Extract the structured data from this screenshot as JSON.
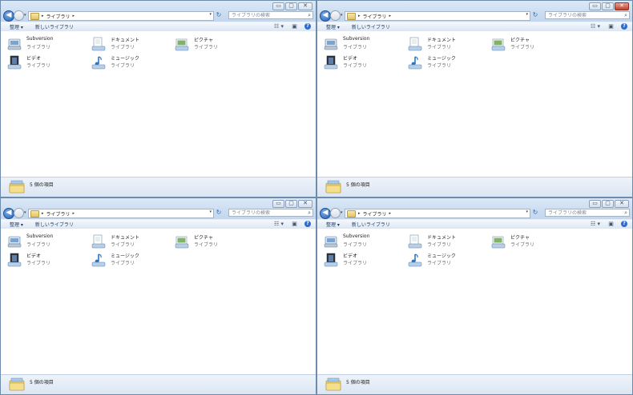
{
  "windows": [
    {
      "close_active": false
    },
    {
      "close_active": true
    },
    {
      "close_active": false
    },
    {
      "close_active": false
    }
  ],
  "caption": {
    "minimize": "▭",
    "maximize": "▢",
    "close": "✕"
  },
  "nav": {
    "back": "◀",
    "dropdown": "▾"
  },
  "address": {
    "path": "ライブラリ",
    "sep": "▸",
    "dropdown": "▾"
  },
  "refresh": "↻",
  "search": {
    "placeholder": "ライブラリの検索",
    "icon": "⌕"
  },
  "toolbar": {
    "organize": "整理 ▾",
    "new_library": "新しいライブラリ",
    "view": "☷ ▾",
    "preview": "▣",
    "help": "?"
  },
  "libraries": [
    {
      "name": "Subversion",
      "type": "ライブラリ",
      "icon": "subversion-library-icon"
    },
    {
      "name": "ドキュメント",
      "type": "ライブラリ",
      "icon": "documents-library-icon"
    },
    {
      "name": "ピクチャ",
      "type": "ライブラリ",
      "icon": "pictures-library-icon"
    },
    {
      "name": "ビデオ",
      "type": "ライブラリ",
      "icon": "videos-library-icon"
    },
    {
      "name": "ミュージック",
      "type": "ライブラリ",
      "icon": "music-library-icon"
    }
  ],
  "status": {
    "count": "5 個の項目"
  },
  "colors": {
    "accent": "#2d6bd0",
    "frame": "#c6d9ef",
    "close_active": "#c43f2c"
  }
}
